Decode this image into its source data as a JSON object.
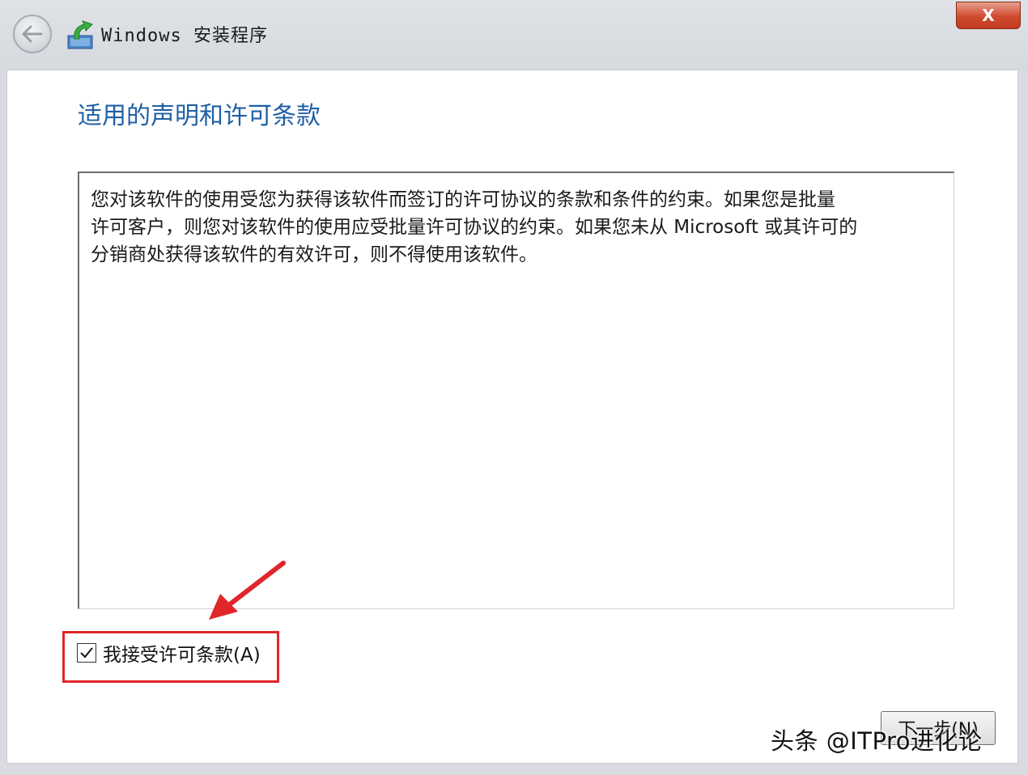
{
  "window": {
    "title": "Windows 安装程序",
    "close_label": "X"
  },
  "page": {
    "title": "适用的声明和许可条款",
    "license_text": "您对该软件的使用受您为获得该软件而签订的许可协议的条款和条件的约束。如果您是批量\n许可客户，则您对该软件的使用应受批量许可协议的约束。如果您未从 Microsoft 或其许可的\n分销商处获得该软件的有效许可，则不得使用该软件。"
  },
  "accept": {
    "label": "我接受许可条款(A)",
    "checked": true
  },
  "buttons": {
    "next_label": "下一步(N)"
  },
  "watermark": "头条 @ITPro进化论",
  "colors": {
    "title_blue": "#1f5fa5",
    "highlight_red": "#e0262b",
    "close_red": "#cf4a2f"
  }
}
